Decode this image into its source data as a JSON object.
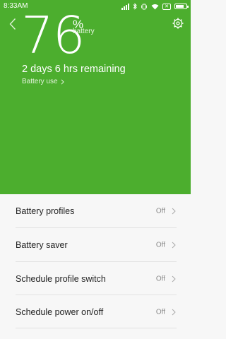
{
  "status_bar": {
    "time": "8:33AM",
    "icons": [
      "signal-icon",
      "bluetooth-icon",
      "vibrate-icon",
      "wifi-icon",
      "no-sim-icon",
      "battery-icon"
    ],
    "battery_level": 0.76
  },
  "header": {
    "percent": "76",
    "percent_sign": "%",
    "percent_label": "battery",
    "remaining": "2 days 6 hrs remaining",
    "battery_use_link": "Battery use"
  },
  "settings": [
    {
      "label": "Battery profiles",
      "value": "Off"
    },
    {
      "label": "Battery saver",
      "value": "Off"
    },
    {
      "label": "Schedule profile switch",
      "value": "Off"
    },
    {
      "label": "Schedule power on/off",
      "value": "Off"
    }
  ],
  "colors": {
    "accent": "#4cae2e",
    "list_background": "#f7f7f7",
    "value_text": "#8a8a8a"
  }
}
